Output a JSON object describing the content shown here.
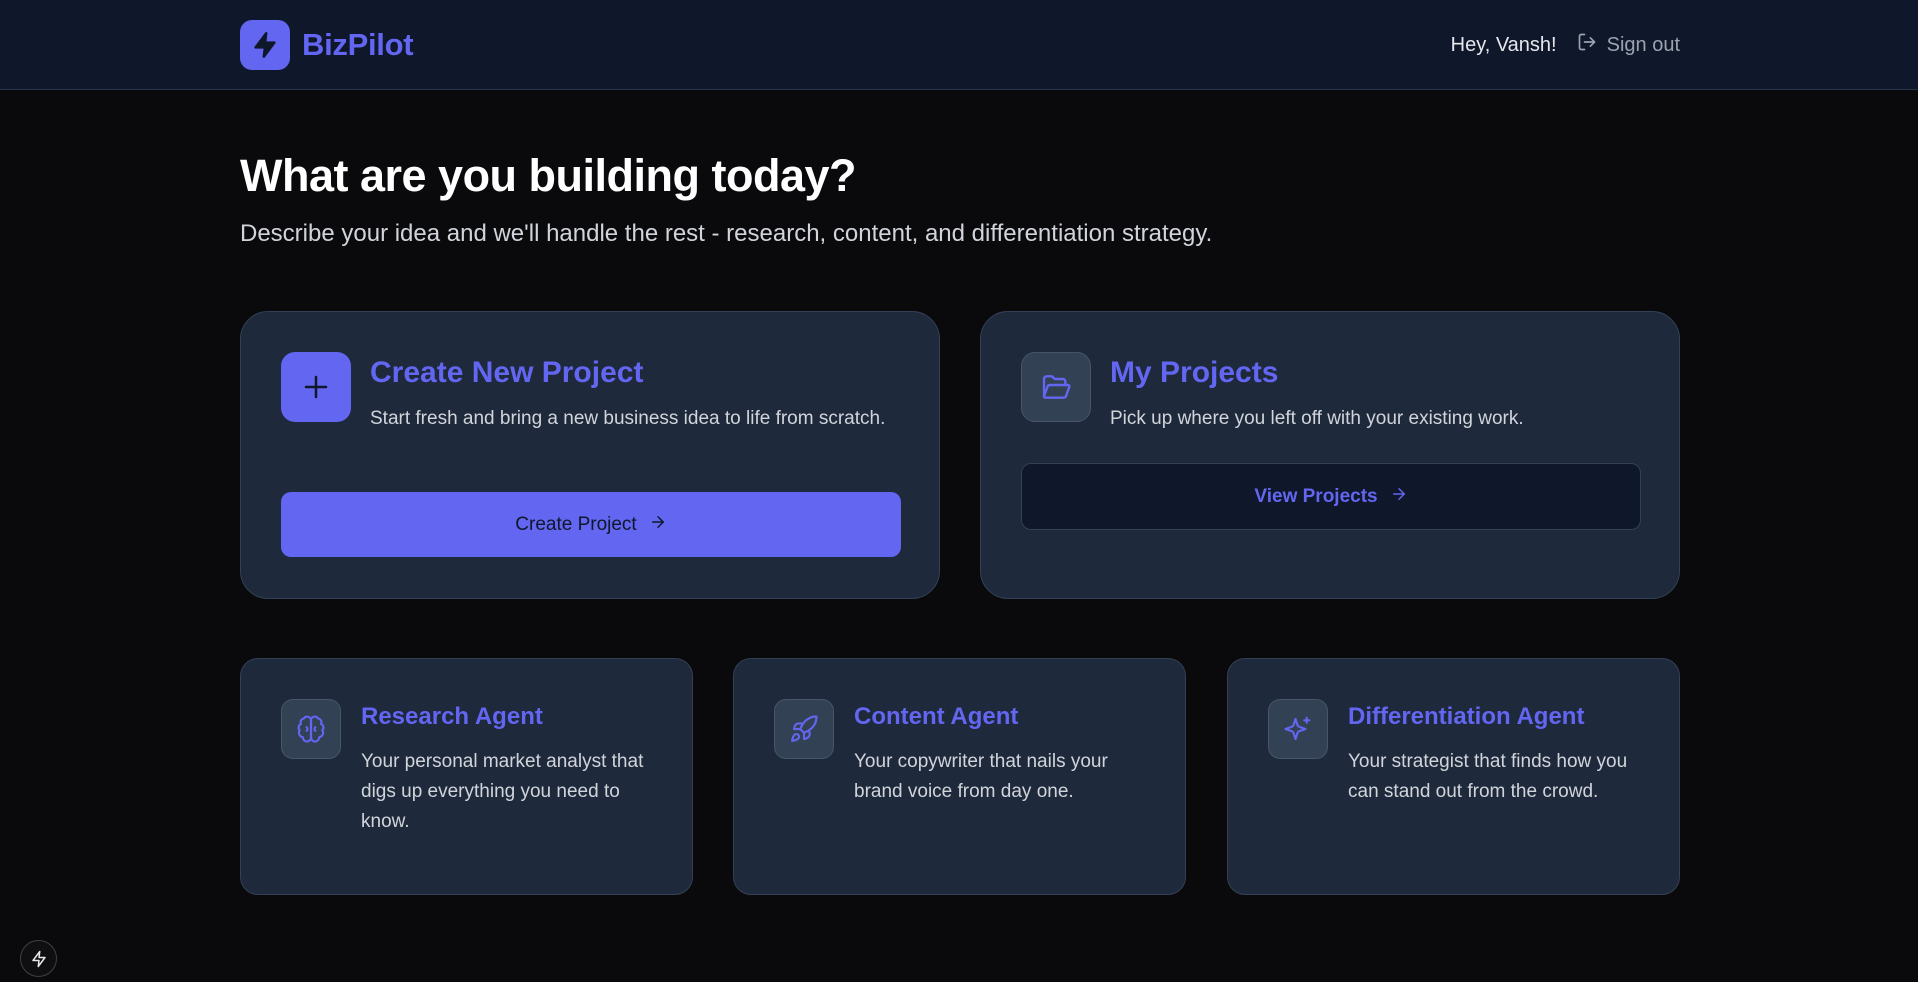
{
  "header": {
    "brand_name": "BizPilot",
    "brand_icon": "lightning-bolt-icon",
    "greeting": "Hey, Vansh!",
    "signout_label": "Sign out",
    "signout_icon": "log-out-icon"
  },
  "hero": {
    "title": "What are you building today?",
    "subtitle": "Describe your idea and we'll handle the rest - research, content, and differentiation strategy."
  },
  "create_card": {
    "icon": "plus-icon",
    "title": "Create New Project",
    "description": "Start fresh and bring a new business idea to life from scratch.",
    "button_label": "Create Project",
    "button_icon": "arrow-right-icon"
  },
  "projects_card": {
    "icon": "folder-open-icon",
    "title": "My Projects",
    "description": "Pick up where you left off with your existing work.",
    "button_label": "View Projects",
    "button_icon": "arrow-right-icon"
  },
  "agents": [
    {
      "icon": "brain-icon",
      "title": "Research Agent",
      "description": "Your personal market analyst that digs up everything you need to know."
    },
    {
      "icon": "rocket-icon",
      "title": "Content Agent",
      "description": "Your copywriter that nails your brand voice from day one."
    },
    {
      "icon": "sparkles-icon",
      "title": "Differentiation Agent",
      "description": "Your strategist that finds how you can stand out from the crowd."
    }
  ],
  "colors": {
    "accent": "#6366f1",
    "background": "#0a0a0c",
    "header_bg": "#0f172a",
    "card_bg": "#1e293b",
    "card_border": "#334155"
  }
}
